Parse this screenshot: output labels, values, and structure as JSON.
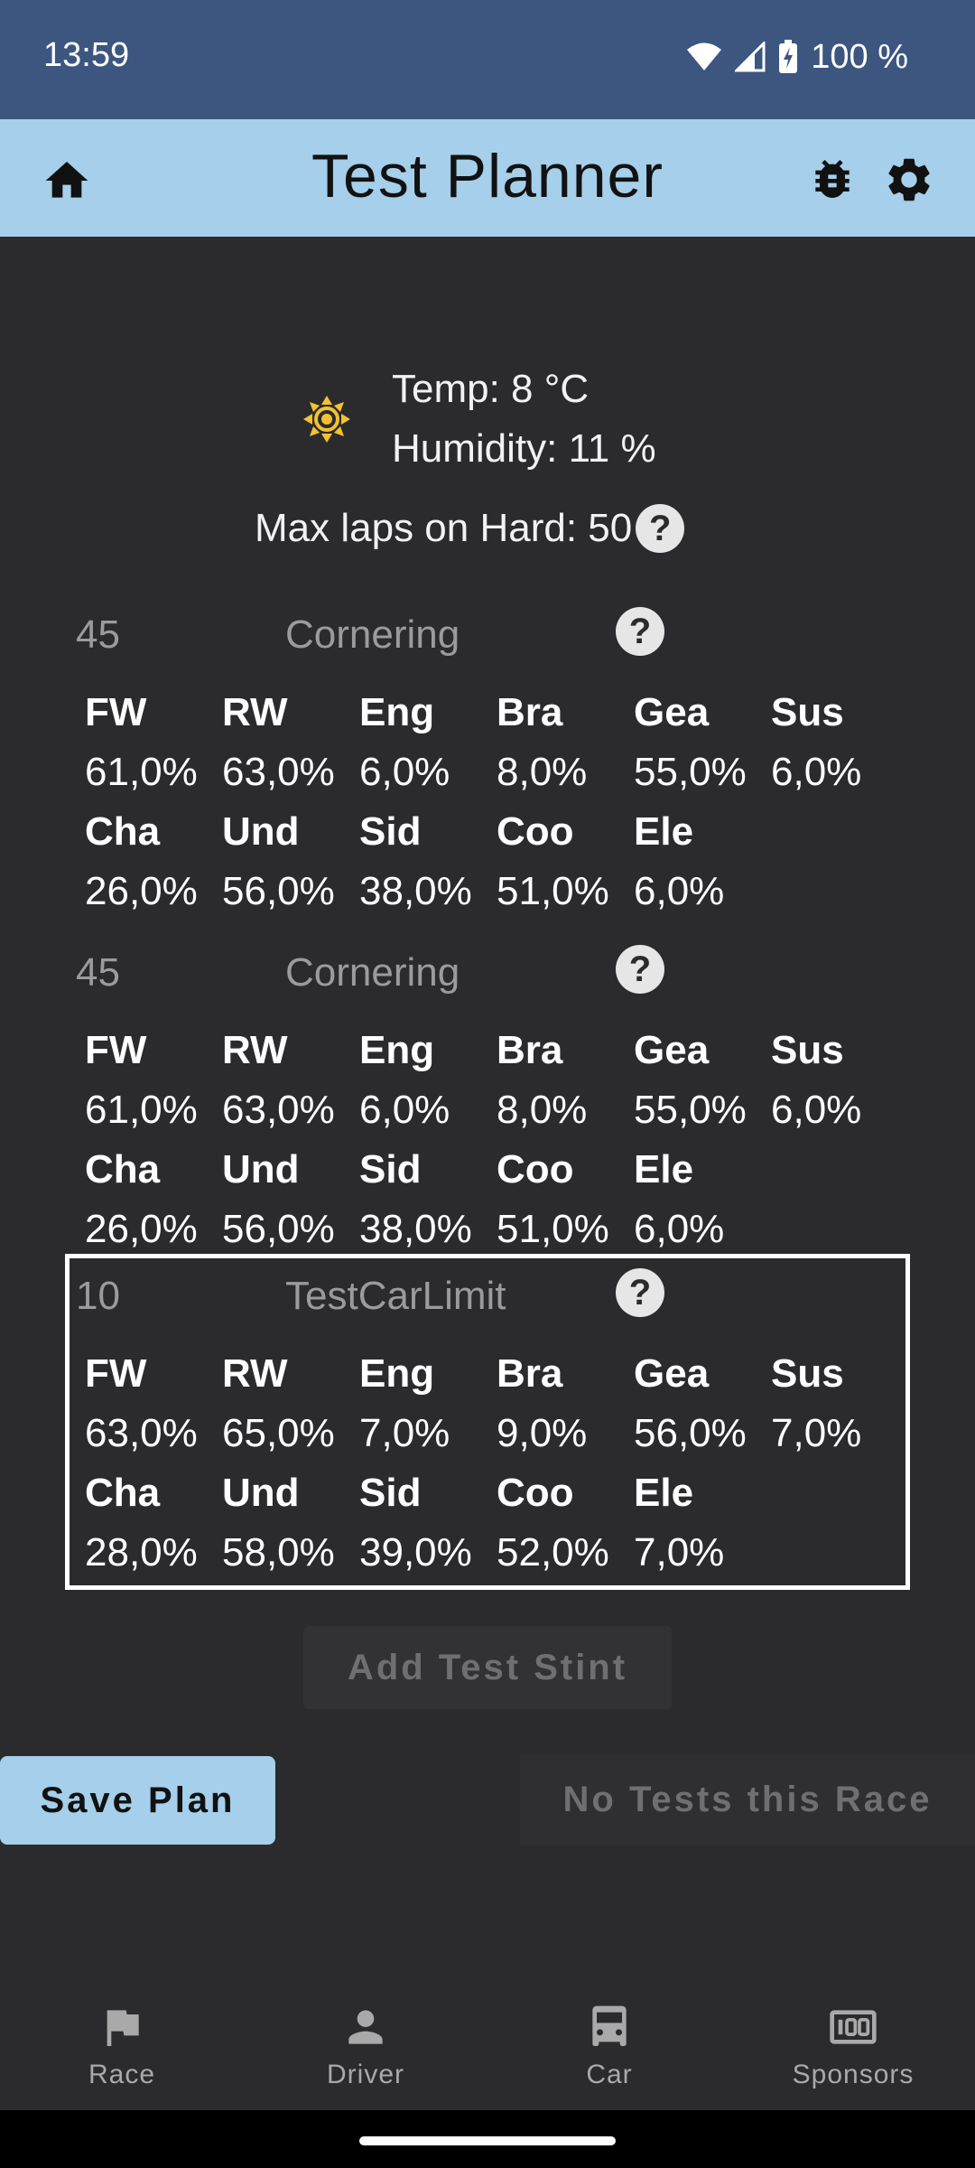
{
  "status_bar": {
    "time": "13:59",
    "battery": "100 %"
  },
  "app_bar": {
    "title": "Test Planner"
  },
  "weather": {
    "temp": "Temp: 8 °C",
    "humidity": "Humidity: 11 %",
    "icon": "sun-icon"
  },
  "max_laps": {
    "text": "Max laps on Hard: 50",
    "help": "?"
  },
  "stints": [
    {
      "laps": "45",
      "type": "Cornering",
      "help": "?",
      "labels_row1": [
        "FW",
        "RW",
        "Eng",
        "Bra",
        "Gea",
        "Sus"
      ],
      "values_row1": [
        "61,0%",
        "63,0%",
        "6,0%",
        "8,0%",
        "55,0%",
        "6,0%"
      ],
      "labels_row2": [
        "Cha",
        "Und",
        "Sid",
        "Coo",
        "Ele"
      ],
      "values_row2": [
        "26,0%",
        "56,0%",
        "38,0%",
        "51,0%",
        "6,0%"
      ]
    },
    {
      "laps": "45",
      "type": "Cornering",
      "help": "?",
      "labels_row1": [
        "FW",
        "RW",
        "Eng",
        "Bra",
        "Gea",
        "Sus"
      ],
      "values_row1": [
        "61,0%",
        "63,0%",
        "6,0%",
        "8,0%",
        "55,0%",
        "6,0%"
      ],
      "labels_row2": [
        "Cha",
        "Und",
        "Sid",
        "Coo",
        "Ele"
      ],
      "values_row2": [
        "26,0%",
        "56,0%",
        "38,0%",
        "51,0%",
        "6,0%"
      ]
    },
    {
      "laps": "10",
      "type": "TestCarLimit",
      "help": "?",
      "labels_row1": [
        "FW",
        "RW",
        "Eng",
        "Bra",
        "Gea",
        "Sus"
      ],
      "values_row1": [
        "63,0%",
        "65,0%",
        "7,0%",
        "9,0%",
        "56,0%",
        "7,0%"
      ],
      "labels_row2": [
        "Cha",
        "Und",
        "Sid",
        "Coo",
        "Ele"
      ],
      "values_row2": [
        "28,0%",
        "58,0%",
        "39,0%",
        "52,0%",
        "7,0%"
      ]
    }
  ],
  "actions": {
    "add_stint": "Add Test Stint",
    "save_plan": "Save Plan",
    "no_tests": "No Tests this Race"
  },
  "bottom_nav": [
    {
      "label": "Race",
      "icon": "flag-icon"
    },
    {
      "label": "Driver",
      "icon": "person-icon"
    },
    {
      "label": "Car",
      "icon": "car-icon"
    },
    {
      "label": "Sponsors",
      "icon": "sponsors-icon"
    }
  ],
  "colors": {
    "app_bar": "#a5cfea",
    "status_bar": "#3c5680",
    "background": "#2b2a2d",
    "sun": "#f2c230"
  }
}
